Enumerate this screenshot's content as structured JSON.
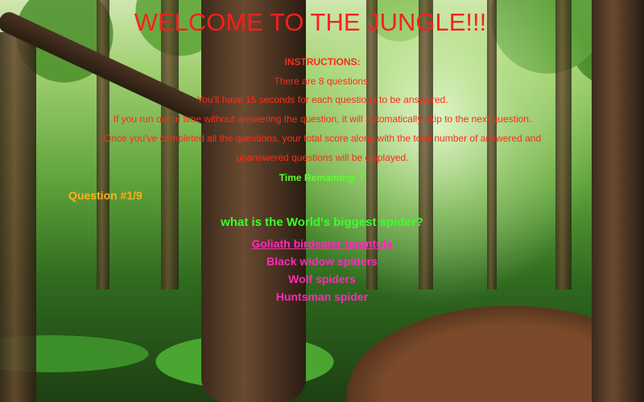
{
  "page": {
    "title": "WELCOME TO THE JUNGLE!!!"
  },
  "instructions": {
    "heading": "INSTRUCTIONS:",
    "lines": [
      "There are 8 questions.",
      "You'll have 15 seconds for each questions to be answered.",
      "If you run out of time without answering the question, it will automatically skip to the next question.",
      "Once you've completed all the questions, your total score along with the total number of answered and",
      "unanswered questions will be displayed."
    ]
  },
  "timer": {
    "text": "Time Remaining: 7"
  },
  "quiz": {
    "counter": "Question #1/9",
    "question": "what is the World's biggest spider?",
    "answers": [
      "Goliath birdeater tarantula",
      "Black widow spiders",
      "Wolf spiders",
      "Huntsman spider"
    ]
  },
  "colors": {
    "title": "#ff1e1e",
    "instructions": "#ff2a1a",
    "timer": "#5cff2c",
    "counter": "#ffb21a",
    "question": "#3cff2c",
    "answers": "#ff2ab8"
  }
}
